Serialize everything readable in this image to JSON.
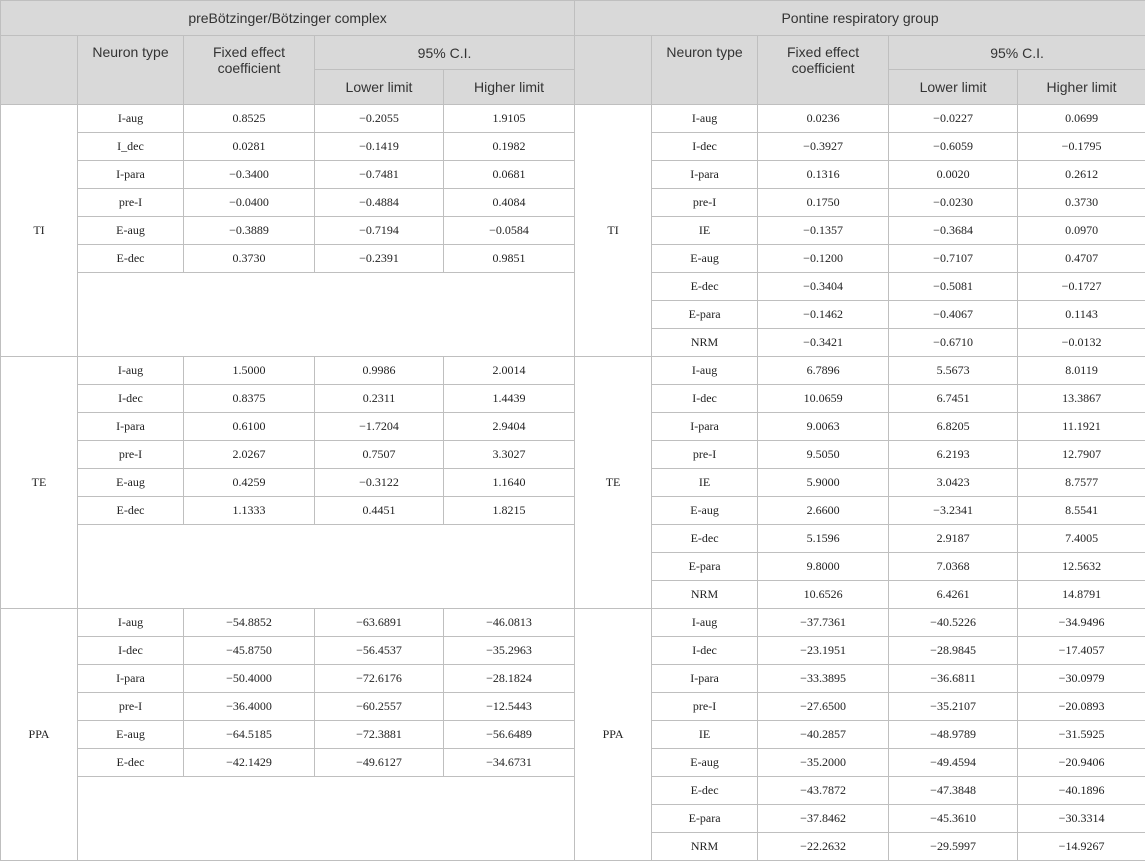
{
  "headers": {
    "left_group": "preBötzinger/Bötzinger complex",
    "right_group": "Pontine respiratory group",
    "neuron_type": "Neuron type",
    "fixed_effect": "Fixed effect coefficient",
    "ci": "95% C.I.",
    "lower": "Lower limit",
    "higher": "Higher limit"
  },
  "sections": [
    {
      "label": "TI",
      "left": [
        [
          "I-aug",
          "0.8525",
          "−0.2055",
          "1.9105"
        ],
        [
          "I_dec",
          "0.0281",
          "−0.1419",
          "0.1982"
        ],
        [
          "I-para",
          "−0.3400",
          "−0.7481",
          "0.0681"
        ],
        [
          "pre-I",
          "−0.0400",
          "−0.4884",
          "0.4084"
        ],
        [
          "E-aug",
          "−0.3889",
          "−0.7194",
          "−0.0584"
        ],
        [
          "E-dec",
          "0.3730",
          "−0.2391",
          "0.9851"
        ]
      ],
      "right": [
        [
          "I-aug",
          "0.0236",
          "−0.0227",
          "0.0699"
        ],
        [
          "I-dec",
          "−0.3927",
          "−0.6059",
          "−0.1795"
        ],
        [
          "I-para",
          "0.1316",
          "0.0020",
          "0.2612"
        ],
        [
          "pre-I",
          "0.1750",
          "−0.0230",
          "0.3730"
        ],
        [
          "IE",
          "−0.1357",
          "−0.3684",
          "0.0970"
        ],
        [
          "E-aug",
          "−0.1200",
          "−0.7107",
          "0.4707"
        ],
        [
          "E-dec",
          "−0.3404",
          "−0.5081",
          "−0.1727"
        ],
        [
          "E-para",
          "−0.1462",
          "−0.4067",
          "0.1143"
        ],
        [
          "NRM",
          "−0.3421",
          "−0.6710",
          "−0.0132"
        ]
      ]
    },
    {
      "label": "TE",
      "left": [
        [
          "I-aug",
          "1.5000",
          "0.9986",
          "2.0014"
        ],
        [
          "I-dec",
          "0.8375",
          "0.2311",
          "1.4439"
        ],
        [
          "I-para",
          "0.6100",
          "−1.7204",
          "2.9404"
        ],
        [
          "pre-I",
          "2.0267",
          "0.7507",
          "3.3027"
        ],
        [
          "E-aug",
          "0.4259",
          "−0.3122",
          "1.1640"
        ],
        [
          "E-dec",
          "1.1333",
          "0.4451",
          "1.8215"
        ]
      ],
      "right": [
        [
          "I-aug",
          "6.7896",
          "5.5673",
          "8.0119"
        ],
        [
          "I-dec",
          "10.0659",
          "6.7451",
          "13.3867"
        ],
        [
          "I-para",
          "9.0063",
          "6.8205",
          "11.1921"
        ],
        [
          "pre-I",
          "9.5050",
          "6.2193",
          "12.7907"
        ],
        [
          "IE",
          "5.9000",
          "3.0423",
          "8.7577"
        ],
        [
          "E-aug",
          "2.6600",
          "−3.2341",
          "8.5541"
        ],
        [
          "E-dec",
          "5.1596",
          "2.9187",
          "7.4005"
        ],
        [
          "E-para",
          "9.8000",
          "7.0368",
          "12.5632"
        ],
        [
          "NRM",
          "10.6526",
          "6.4261",
          "14.8791"
        ]
      ]
    },
    {
      "label": "PPA",
      "left": [
        [
          "I-aug",
          "−54.8852",
          "−63.6891",
          "−46.0813"
        ],
        [
          "I-dec",
          "−45.8750",
          "−56.4537",
          "−35.2963"
        ],
        [
          "I-para",
          "−50.4000",
          "−72.6176",
          "−28.1824"
        ],
        [
          "pre-I",
          "−36.4000",
          "−60.2557",
          "−12.5443"
        ],
        [
          "E-aug",
          "−64.5185",
          "−72.3881",
          "−56.6489"
        ],
        [
          "E-dec",
          "−42.1429",
          "−49.6127",
          "−34.6731"
        ]
      ],
      "right": [
        [
          "I-aug",
          "−37.7361",
          "−40.5226",
          "−34.9496"
        ],
        [
          "I-dec",
          "−23.1951",
          "−28.9845",
          "−17.4057"
        ],
        [
          "I-para",
          "−33.3895",
          "−36.6811",
          "−30.0979"
        ],
        [
          "pre-I",
          "−27.6500",
          "−35.2107",
          "−20.0893"
        ],
        [
          "IE",
          "−40.2857",
          "−48.9789",
          "−31.5925"
        ],
        [
          "E-aug",
          "−35.2000",
          "−49.4594",
          "−20.9406"
        ],
        [
          "E-dec",
          "−43.7872",
          "−47.3848",
          "−40.1896"
        ],
        [
          "E-para",
          "−37.8462",
          "−45.3610",
          "−30.3314"
        ],
        [
          "NRM",
          "−22.2632",
          "−29.5997",
          "−14.9267"
        ]
      ]
    }
  ]
}
